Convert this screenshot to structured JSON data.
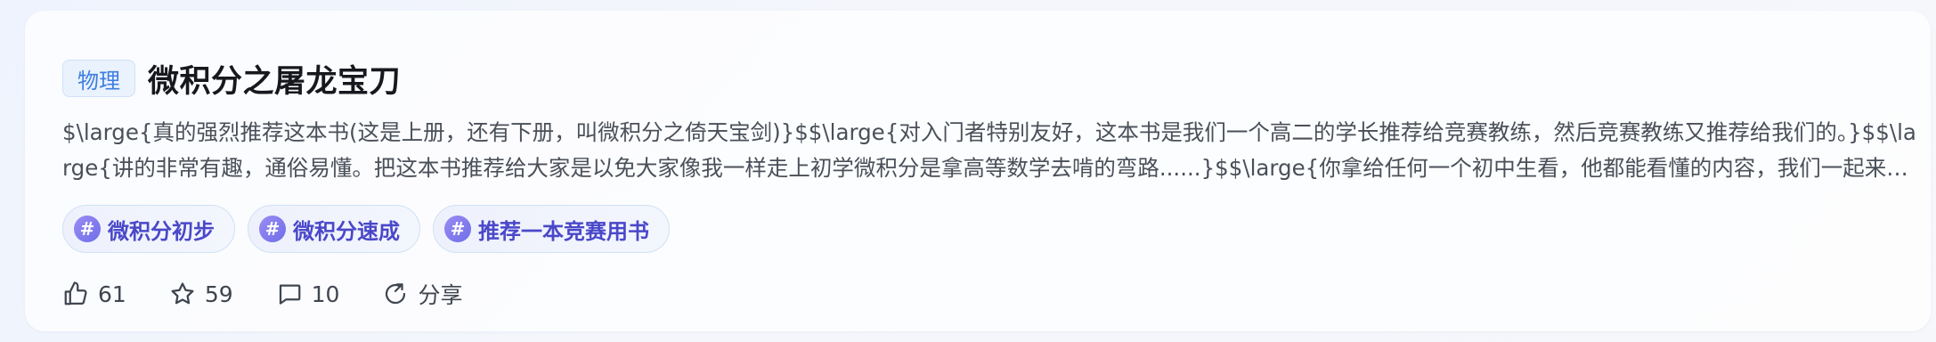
{
  "post": {
    "category": "物理",
    "title": "微积分之屠龙宝刀",
    "excerpt": "$\\large{真的强烈推荐这本书(这是上册，还有下册，叫微积分之倚天宝剑)}$$\\large{对入门者特别友好，这本书是我们一个高二的学长推荐给竞赛教练，然后竞赛教练又推荐给我们的。}$$\\large{讲的非常有趣，通俗易懂。把这本书推荐给大家是以免大家像我一样走上初学微积分是拿高等数学去啃的弯路......}$$\\large{你拿给任何一个初中生看，他都能看懂的内容，我们一起来学吧！}$"
  },
  "tags": [
    {
      "icon": "hashtag-icon",
      "label": "微积分初步"
    },
    {
      "icon": "hashtag-icon",
      "label": "微积分速成"
    },
    {
      "icon": "hashtag-icon",
      "label": "推荐一本竞赛用书"
    }
  ],
  "actions": {
    "like": {
      "icon": "thumbs-up-icon",
      "count": "61"
    },
    "favorite": {
      "icon": "star-icon",
      "count": "59"
    },
    "comment": {
      "icon": "comment-icon",
      "count": "10"
    },
    "share": {
      "icon": "share-icon",
      "label": "分享"
    }
  },
  "colors": {
    "category_text": "#3d7ee0",
    "category_bg": "#eaf2fd",
    "tag_text": "#4a48c9",
    "tag_icon": "#7b76ee"
  }
}
